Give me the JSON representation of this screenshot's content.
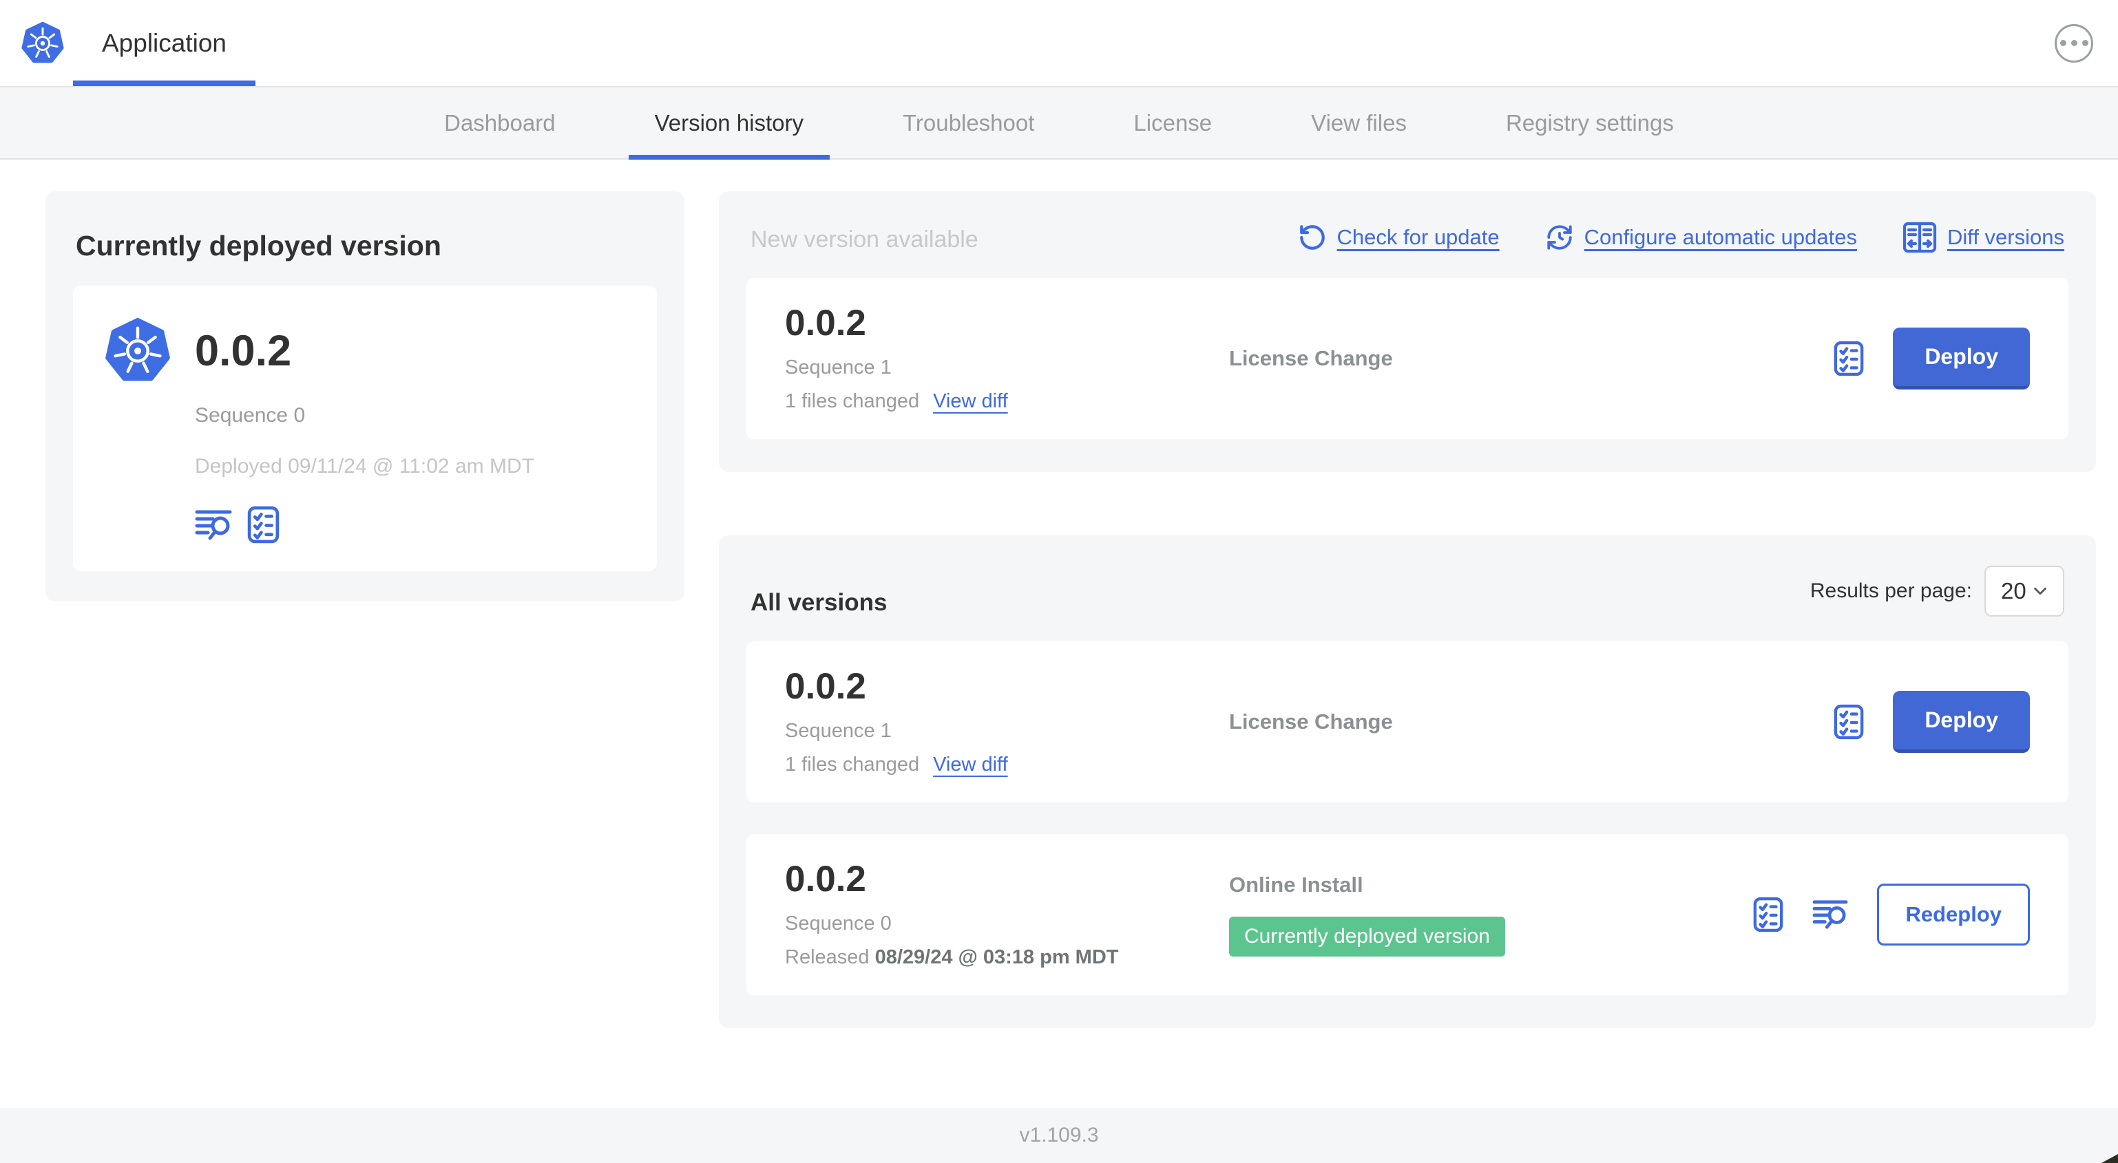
{
  "header": {
    "app_title": "Application"
  },
  "tabs": [
    {
      "label": "Dashboard",
      "active": false
    },
    {
      "label": "Version history",
      "active": true
    },
    {
      "label": "Troubleshoot",
      "active": false
    },
    {
      "label": "License",
      "active": false
    },
    {
      "label": "View files",
      "active": false
    },
    {
      "label": "Registry settings",
      "active": false
    }
  ],
  "colors": {
    "accent_blue": "#3e6ae1",
    "button_blue": "#4268d6",
    "badge_green": "#5cc48e",
    "section_bg": "#f5f6f8"
  },
  "currently_deployed": {
    "title": "Currently deployed version",
    "version": "0.0.2",
    "sequence": "Sequence 0",
    "deployed": "Deployed 09/11/24 @ 11:02 am MDT"
  },
  "new_version": {
    "title": "New version available",
    "links": [
      {
        "label": "Check for update",
        "icon": "refresh-icon"
      },
      {
        "label": "Configure automatic updates",
        "icon": "clock-refresh-icon"
      },
      {
        "label": "Diff versions",
        "icon": "diff-icon"
      }
    ],
    "row": {
      "version": "0.0.2",
      "sequence": "Sequence 1",
      "files_changed": "1 files changed",
      "view_diff": "View diff",
      "source": "License Change",
      "action": "Deploy"
    }
  },
  "all_versions": {
    "title": "All versions",
    "results_per_page_label": "Results per page:",
    "results_per_page_value": "20",
    "rows": [
      {
        "version": "0.0.2",
        "sequence": "Sequence 1",
        "files_changed": "1 files changed",
        "view_diff": "View diff",
        "source": "License Change",
        "action": "Deploy"
      },
      {
        "version": "0.0.2",
        "sequence": "Sequence 0",
        "released_prefix": "Released",
        "released_date": "08/29/24 @ 03:18 pm MDT",
        "source": "Online Install",
        "badge": "Currently deployed version",
        "action": "Redeploy"
      }
    ]
  },
  "footer": {
    "version": "v1.109.3"
  }
}
